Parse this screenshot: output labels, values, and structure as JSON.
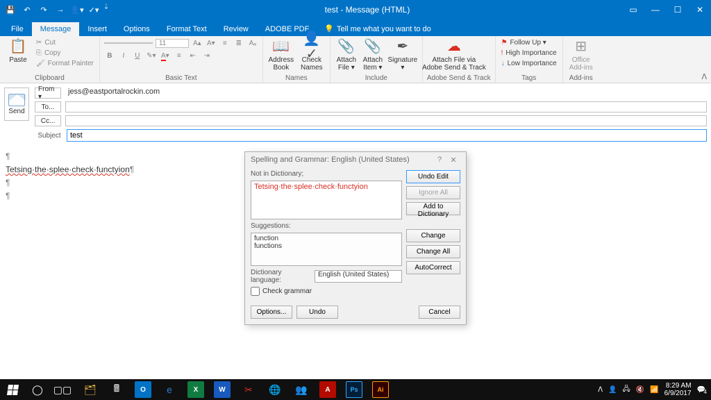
{
  "title": "test - Message (HTML)",
  "qat": {
    "save": "💾",
    "undo": "↶",
    "redo": "↷",
    "fwd": "→"
  },
  "tabs": [
    "File",
    "Message",
    "Insert",
    "Options",
    "Format Text",
    "Review",
    "ADOBE PDF"
  ],
  "tell_me": "Tell me what you want to do",
  "ribbon": {
    "clipboard": {
      "paste": "Paste",
      "cut": "Cut",
      "copy": "Copy",
      "painter": "Format Painter",
      "label": "Clipboard"
    },
    "basic_text": {
      "font_size": "11",
      "label": "Basic Text"
    },
    "names": {
      "address": "Address\nBook",
      "check": "Check\nNames",
      "label": "Names"
    },
    "include": {
      "attach_file": "Attach\nFile ▾",
      "attach_item": "Attach\nItem ▾",
      "sig": "Signature\n▾",
      "label": "Include"
    },
    "adobe": {
      "btn": "Attach File via\nAdobe Send & Track",
      "label": "Adobe Send & Track"
    },
    "tags": {
      "follow": "Follow Up ▾",
      "high": "High Importance",
      "low": "Low Importance",
      "label": "Tags"
    },
    "addins": {
      "office": "Office\nAdd-ins",
      "label": "Add-ins"
    }
  },
  "compose": {
    "send": "Send",
    "from_btn": "From ▾",
    "from_val": "jess@eastportalrockin.com",
    "to_btn": "To...",
    "to_val": "",
    "cc_btn": "Cc...",
    "cc_val": "",
    "subject_lbl": "Subject",
    "subject_val": "test"
  },
  "body_line": "Tetsing·the·splee·check·functyion",
  "dialog": {
    "title": "Spelling and Grammar: English (United States)",
    "not_in": "Not in Dictionary;",
    "text": "Tetsing·the·splee·check·functyion",
    "suggestions_lbl": "Suggestions:",
    "suggestions": [
      "function",
      "functions"
    ],
    "lang_lbl": "Dictionary language:",
    "lang_val": "English (United States)",
    "check_grammar": "Check grammar",
    "btn_undo": "Undo Edit",
    "btn_ignore": "Ignore All",
    "btn_add": "Add to Dictionary",
    "btn_change": "Change",
    "btn_changeall": "Change All",
    "btn_auto": "AutoCorrect",
    "btn_options": "Options...",
    "btn_undo2": "Undo",
    "btn_cancel": "Cancel"
  },
  "tray": {
    "time": "8:29 AM",
    "date": "6/9/2017",
    "badge": "4"
  }
}
